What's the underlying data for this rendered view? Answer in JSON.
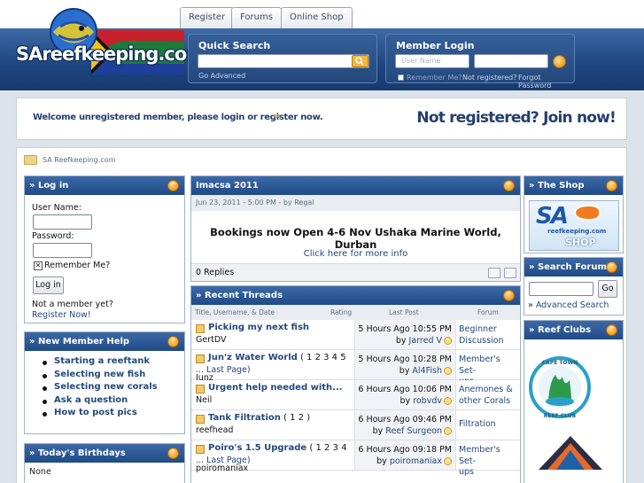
{
  "header": {
    "logo_text": "SAreefkeeping.com",
    "tabs": [
      "Register",
      "Forums",
      "Online Shop"
    ],
    "quick_search": {
      "title": "Quick Search",
      "go_advanced": "Go Advanced"
    },
    "member_login": {
      "title": "Member Login",
      "username_placeholder": "User Name",
      "remember_me": "Remember Me?",
      "not_registered": "Not registered?",
      "forgot_password": "Forgot Password"
    }
  },
  "welcome": {
    "message": "Welcome unregistered member, please login or register now.",
    "join": "Not registered? Join now!"
  },
  "breadcrumb": {
    "text": "SA Reefkeeping.com"
  },
  "login_panel": {
    "title": "» Log in",
    "username_label": "User Name:",
    "password_label": "Password:",
    "remember_label": "Remember Me?",
    "login_button": "Log in",
    "not_member": "Not a member yet?",
    "register_link": "Register Now!"
  },
  "help_panel": {
    "title": "» New Member Help",
    "items": [
      "Starting a reeftank",
      "Selecting new fish",
      "Selecting new corals",
      "Ask a question",
      "How to post pics"
    ]
  },
  "birthday_panel": {
    "title": "» Today's Birthdays",
    "value": "None"
  },
  "news": {
    "title": "Imacsa 2011",
    "meta": "Jun 23, 2011 - 5:00 PM - by Regal",
    "headline": "Bookings now Open 4-6 Nov Ushaka Marine World, Durban",
    "link": "Click here for more info",
    "replies": "0 Replies"
  },
  "threads": {
    "title": "» Recent Threads",
    "columns": {
      "title": "Title, Username, & Date",
      "rating": "Rating",
      "last_post": "Last Post",
      "forum": "Forum"
    },
    "rows": [
      {
        "title": "Picking my next fish",
        "pages": "",
        "author": "GertDV",
        "time": "5 Hours Ago 10:55 PM",
        "by_prefix": "by ",
        "last_user": "Jarred V",
        "forum": [
          "Beginner",
          "Discussion"
        ]
      },
      {
        "title": "Jun'z Water World",
        "pages": " ( 1 2 3 4 5",
        "pages2": "... Last Page)",
        "author": "Junz",
        "time": "5 Hours Ago 10:28 PM",
        "by_prefix": "by ",
        "last_user": "Al4Fish",
        "forum": [
          "Member's Set-",
          "ups"
        ]
      },
      {
        "title": "Urgent help needed with...",
        "pages": "",
        "author": "Neil",
        "time": "6 Hours Ago 10:06 PM",
        "by_prefix": "by ",
        "last_user": "robvdv",
        "forum": [
          "Anemones &",
          "other Corals"
        ]
      },
      {
        "title": "Tank Filtration",
        "pages": " ( 1 2 )",
        "author": "reefhead",
        "time": "6 Hours Ago 09:46 PM",
        "by_prefix": "by ",
        "last_user": "Reef Surgeon",
        "forum": [
          "Filtration"
        ]
      },
      {
        "title": "Poiro's 1.5 Upgrade",
        "pages": " ( 1 2 3 4",
        "pages2": "... Last Page)",
        "author": "poiromaniax",
        "time": "6 Hours Ago 09:18 PM",
        "by_prefix": "by ",
        "last_user": "poiromaniax",
        "forum": [
          "Member's Set-",
          "ups"
        ]
      }
    ]
  },
  "shop_panel": {
    "title": "» The Shop",
    "banner_sa": "SA",
    "banner_url": "reefkeeping.com",
    "banner_word": "SHOP"
  },
  "search_panel": {
    "title": "» Search Forums",
    "go": "Go",
    "advanced_prefix": "» ",
    "advanced": "Advanced Search"
  },
  "clubs_panel": {
    "title": "» Reef Clubs",
    "club_name": "CAPE TOWN REEF CLUB"
  },
  "colors": {
    "header_blue": "#1f4a86",
    "link_blue": "#22497d",
    "accent_orange": "#f0a020"
  }
}
